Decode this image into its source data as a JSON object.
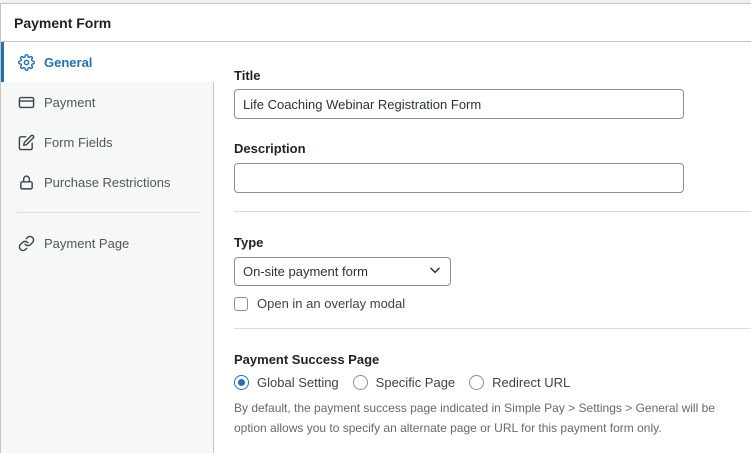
{
  "panel": {
    "title": "Payment Form"
  },
  "sidebar": {
    "items": [
      {
        "label": "General",
        "icon": "gear-icon"
      },
      {
        "label": "Payment",
        "icon": "credit-card-icon"
      },
      {
        "label": "Form Fields",
        "icon": "edit-icon"
      },
      {
        "label": "Purchase Restrictions",
        "icon": "lock-icon"
      },
      {
        "label": "Payment Page",
        "icon": "link-icon"
      }
    ]
  },
  "general": {
    "title_label": "Title",
    "title_value": "Life Coaching Webinar Registration Form",
    "description_label": "Description",
    "description_value": "",
    "type_label": "Type",
    "type_selected": "On-site payment form",
    "overlay_label": "Open in an overlay modal",
    "success_label": "Payment Success Page",
    "success_options": [
      "Global Setting",
      "Specific Page",
      "Redirect URL"
    ],
    "success_selected": "Global Setting",
    "help_line1": "By default, the payment success page indicated in Simple Pay > Settings > General will be",
    "help_line2": "option allows you to specify an alternate page or URL for this payment form only."
  },
  "colors": {
    "accent": "#2271b1",
    "border": "#c3c4c7",
    "sidebar_bg": "#f6f7f7"
  }
}
